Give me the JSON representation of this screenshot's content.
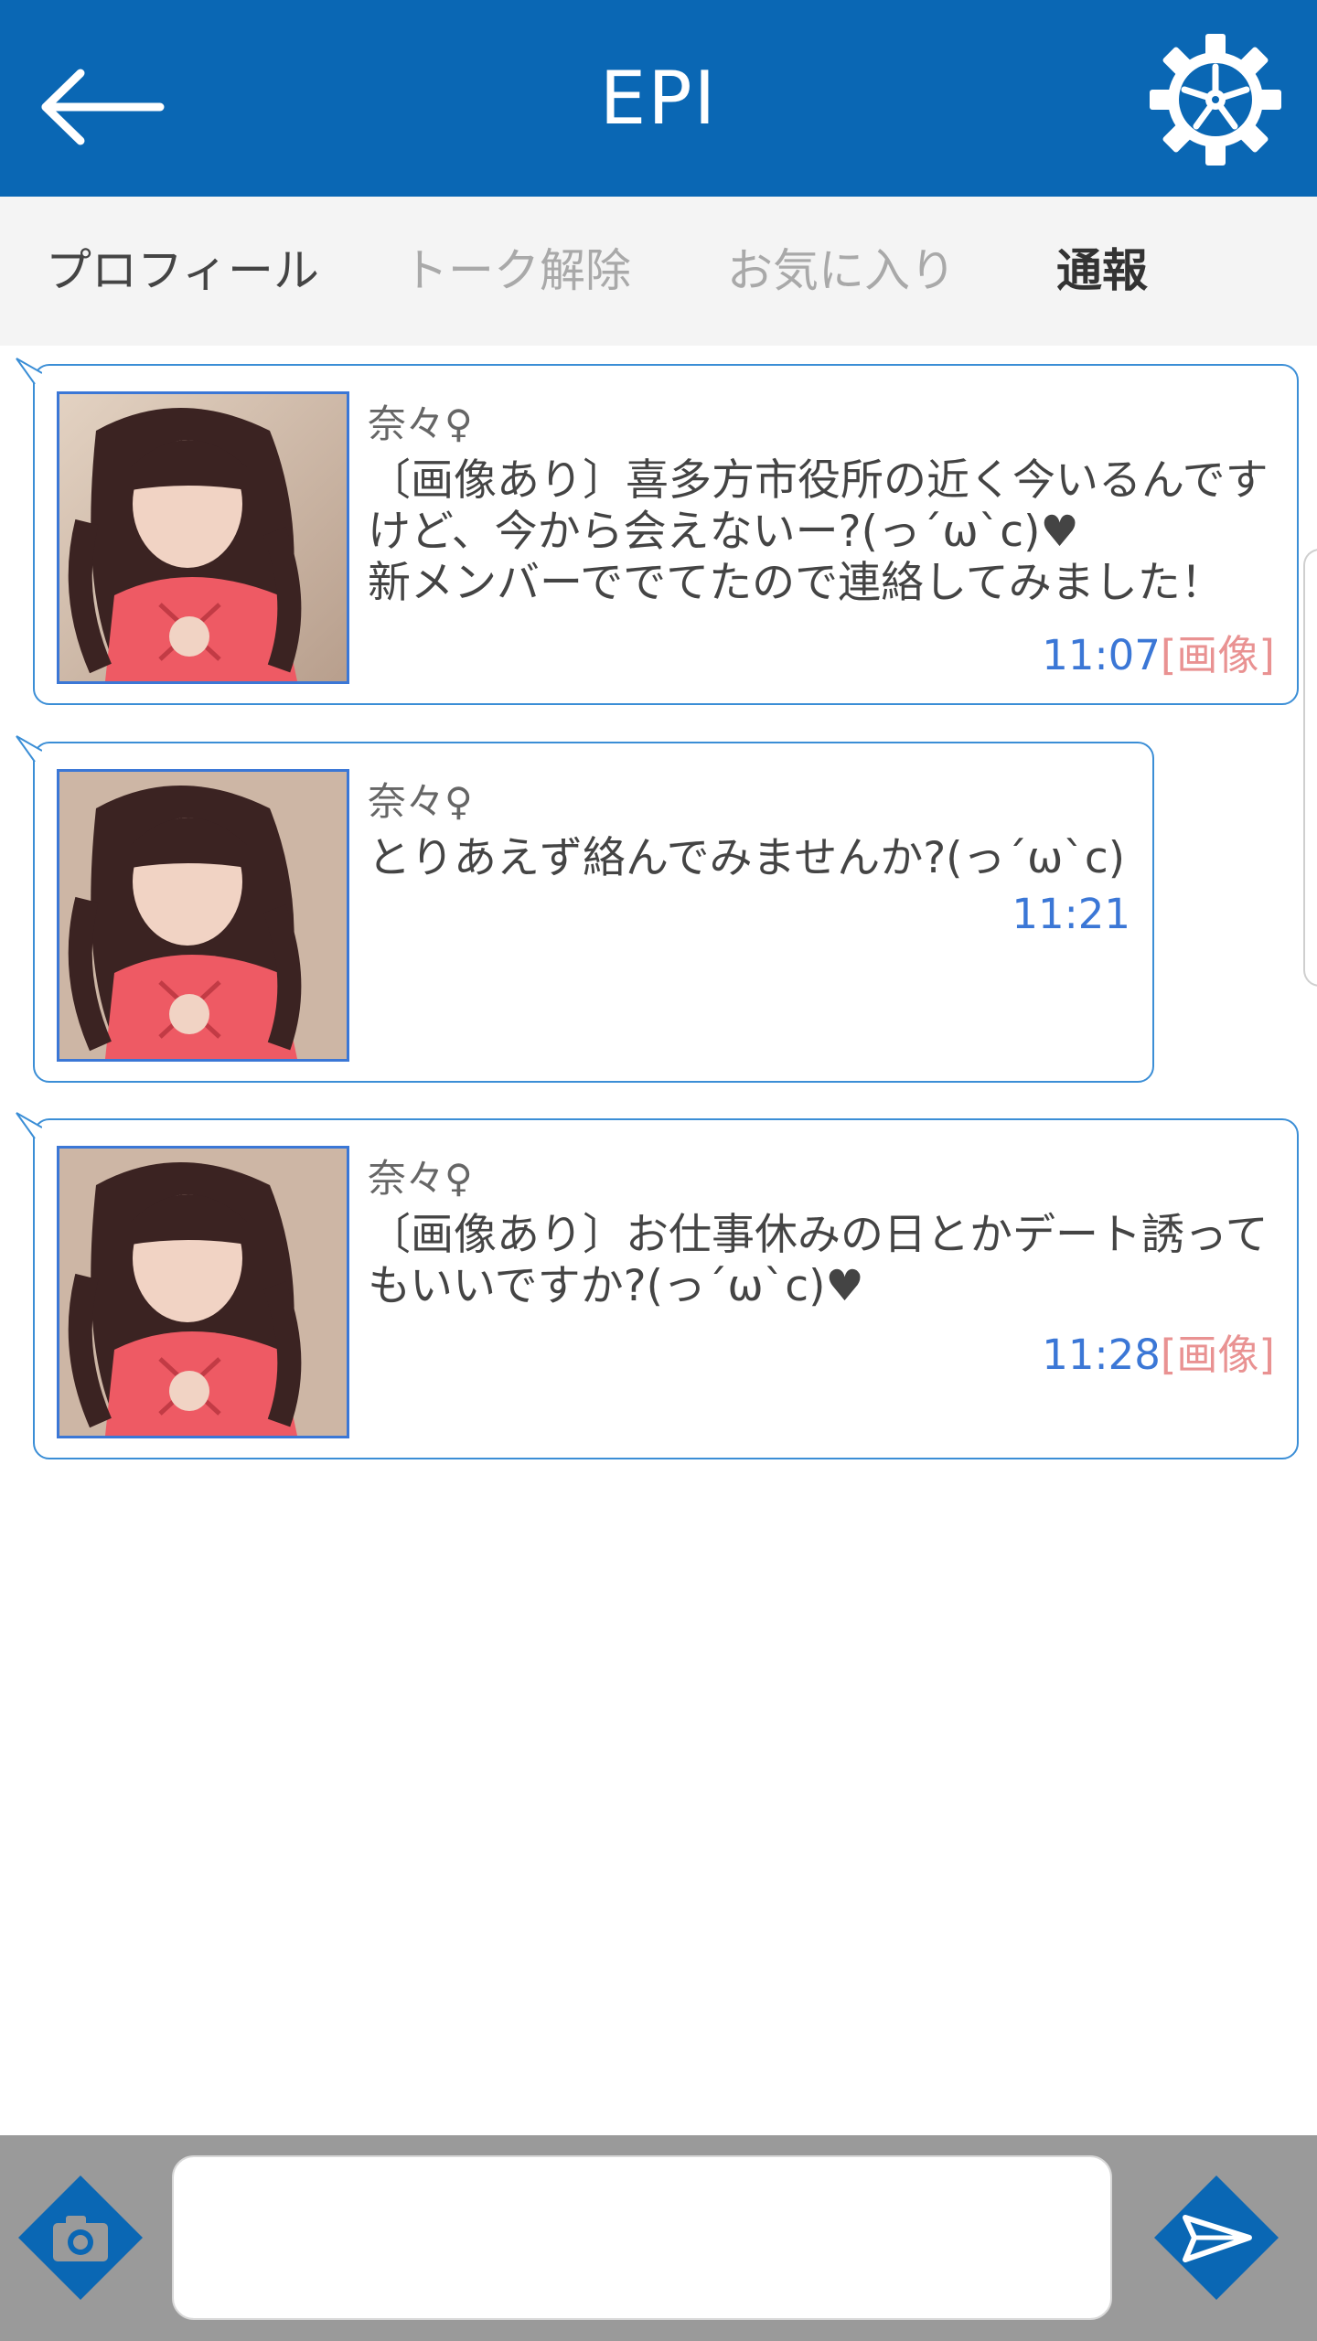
{
  "header": {
    "title": "EPI",
    "back_icon": "left-arrow-icon",
    "settings_icon": "gear-icon",
    "color": "#0a67b4"
  },
  "tabs": [
    {
      "label": "プロフィール"
    },
    {
      "label": "トーク解除"
    },
    {
      "label": "お気に入り"
    },
    {
      "label": "通報"
    }
  ],
  "messages": [
    {
      "sender": "奈々♀",
      "text": "〔画像あり〕喜多方市役所の近く今いるんです\nけど、今から会えないー?(っ´ω`c)♥\n新メンバーででてたので連絡してみました！",
      "time": "11:07",
      "image_tag": "[画像]"
    },
    {
      "sender": "奈々♀",
      "text": "とりあえず絡んでみませんか?(っ´ω`c)",
      "time": "11:21",
      "image_tag": ""
    },
    {
      "sender": "奈々♀",
      "text": "〔画像あり〕お仕事休みの日とかデート誘って\nもいいですか?(っ´ω`c)♥",
      "time": "11:28",
      "image_tag": "[画像]"
    }
  ],
  "composer": {
    "camera_icon": "camera-icon",
    "send_icon": "send-icon",
    "input_value": "",
    "input_placeholder": ""
  },
  "colors": {
    "accent": "#3b8ed6",
    "time": "#3b77d6",
    "image_tag": "#e99292"
  }
}
